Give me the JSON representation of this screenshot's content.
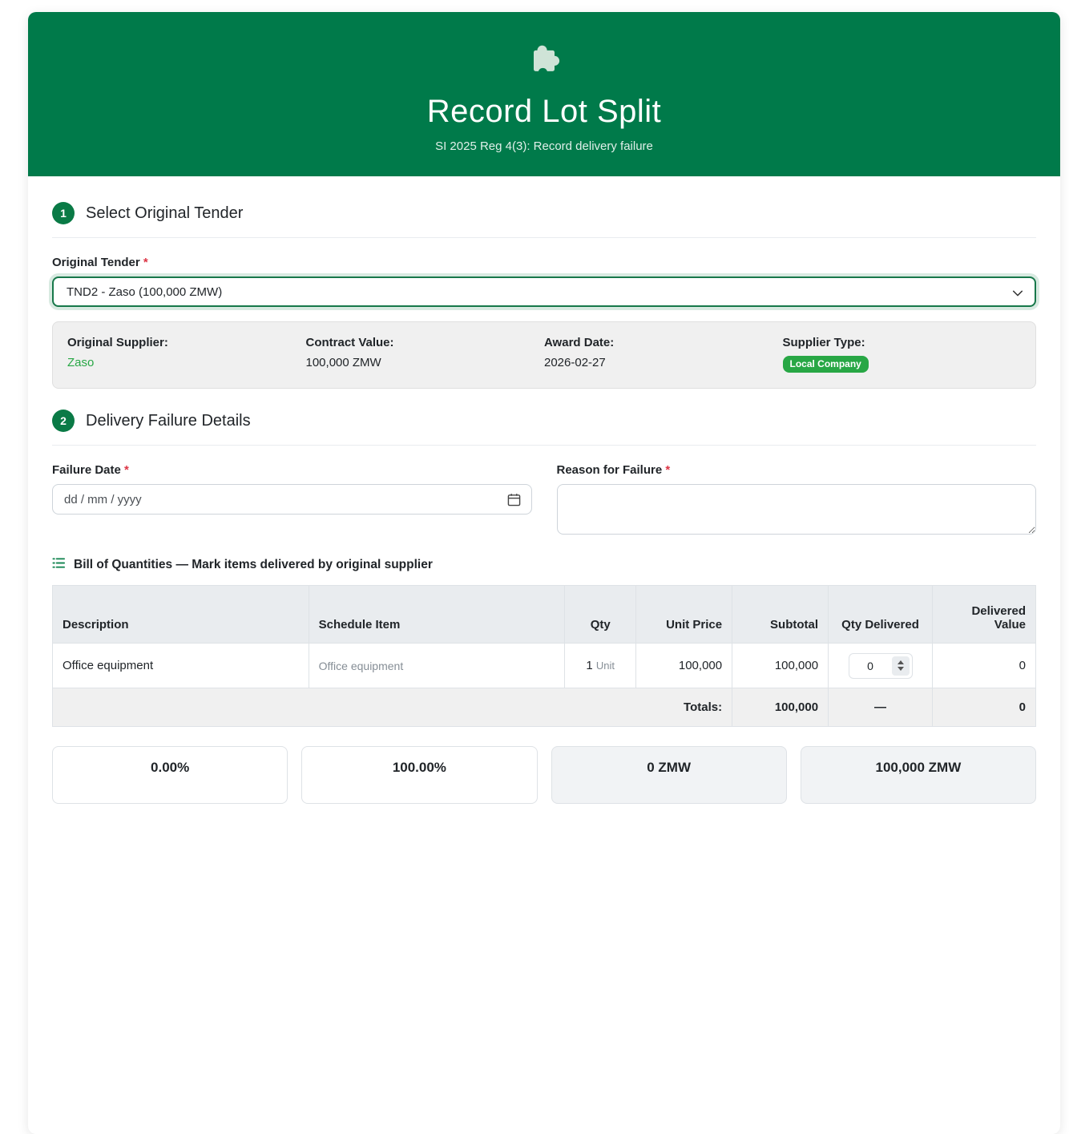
{
  "ui": {
    "required_mark": "*"
  },
  "header": {
    "title": "Record Lot Split",
    "subtitle": "SI 2025 Reg 4(3): Record delivery failure"
  },
  "sections": {
    "tender": {
      "number": "1",
      "title": "Select Original Tender",
      "field_label": "Original Tender",
      "select_value": "TND2 - Zaso (100,000 ZMW)"
    },
    "failure": {
      "number": "2",
      "title": "Delivery Failure Details",
      "date_label": "Failure Date",
      "date_placeholder": "dd / mm / yyyy",
      "reason_label": "Reason for Failure"
    }
  },
  "tender_info": {
    "items": [
      {
        "label": "Original Supplier:",
        "value": "Zaso"
      },
      {
        "label": "Contract Value:",
        "value": "100,000 ZMW"
      },
      {
        "label": "Award Date:",
        "value": "2026-02-27"
      },
      {
        "label": "Supplier Type:",
        "badge": "Local Company"
      }
    ]
  },
  "boq": {
    "heading": "Bill of Quantities — Mark items delivered by original supplier",
    "columns": {
      "description": "Description",
      "schedule_item": "Schedule Item",
      "qty": "Qty",
      "unit_price": "Unit Price",
      "subtotal": "Subtotal",
      "qty_delivered": "Qty Delivered",
      "delivered_value": "Delivered Value"
    },
    "rows": [
      {
        "description": "Office equipment",
        "schedule_item": "Office equipment",
        "qty": "1",
        "qty_unit": "Unit",
        "unit_price": "100,000",
        "subtotal": "100,000",
        "qty_delivered_value": "0",
        "delivered_value": "0"
      }
    ],
    "totals": {
      "label": "Totals:",
      "subtotal": "100,000",
      "qty_delivered": "—",
      "delivered_value": "0"
    }
  },
  "summary_cards": [
    {
      "value": "0.00%"
    },
    {
      "value": "100.00%"
    },
    {
      "value": "0 ZMW"
    },
    {
      "value": "100,000 ZMW"
    }
  ],
  "colors": {
    "header_green": "#007a4a",
    "accent_green": "#28a745",
    "danger_red": "#dc3545",
    "table_header_bg": "#e9ecef"
  }
}
